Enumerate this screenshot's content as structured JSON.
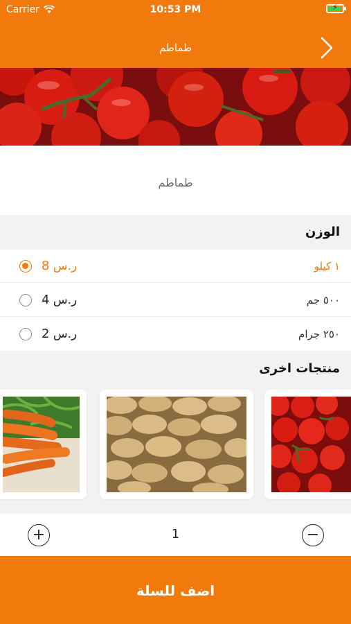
{
  "status_bar": {
    "carrier": "Carrier",
    "time": "10:53 PM"
  },
  "nav": {
    "title": "طماطم",
    "back_icon": "chevron-right-icon"
  },
  "product": {
    "name": "طماطم",
    "image": "tomatoes-photo"
  },
  "weight_section": {
    "title": "الوزن",
    "options": [
      {
        "label": "١ كيلو",
        "price_num": "8",
        "price_unit": "ر.س",
        "selected": true
      },
      {
        "label": "٥٠٠ جم",
        "price_num": "4",
        "price_unit": "ر.س",
        "selected": false
      },
      {
        "label": "٢٥٠ جرام",
        "price_num": "2",
        "price_unit": "ر.س",
        "selected": false
      }
    ]
  },
  "other_products": {
    "title": "منتجات اخرى",
    "items": [
      "carrots-photo",
      "potatoes-photo",
      "tomatoes-photo"
    ]
  },
  "quantity": {
    "value": "1",
    "plus_symbol": "+",
    "minus_symbol": "−"
  },
  "cart": {
    "add_label": "اضف للسلة"
  },
  "colors": {
    "accent": "#f27a0d",
    "background": "#f2f2f4"
  }
}
